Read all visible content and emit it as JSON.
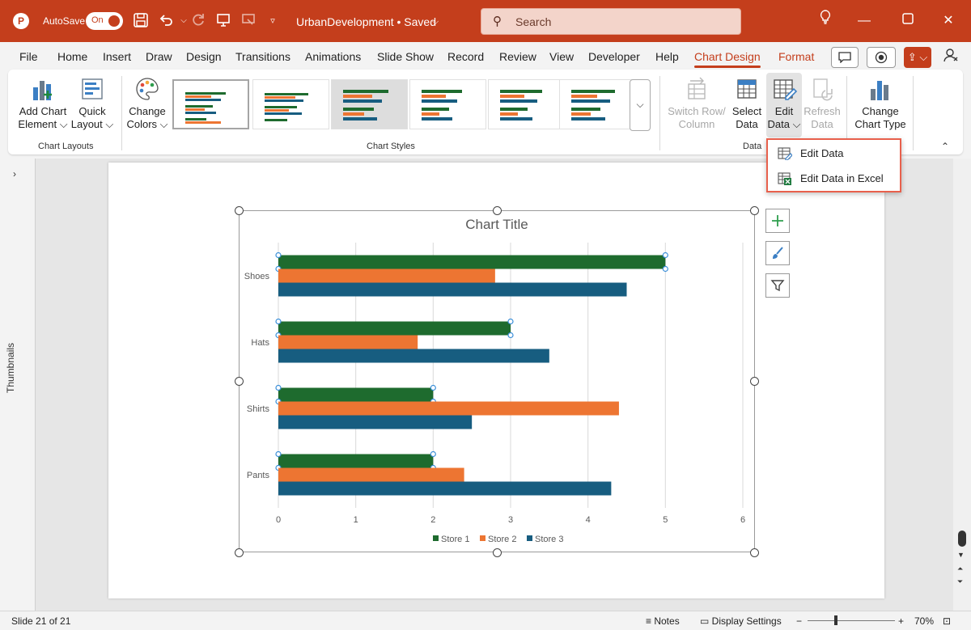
{
  "titlebar": {
    "app_icon": "P",
    "autosave_label": "AutoSave",
    "autosave_state": "On",
    "doc_title": "UrbanDevelopment • Saved",
    "search_placeholder": "Search",
    "icons": [
      "save-icon",
      "undo-icon",
      "redo-icon",
      "present-icon",
      "customize-icon",
      "lightbulb-icon",
      "minimize-icon",
      "maximize-icon",
      "close-icon"
    ]
  },
  "menu": {
    "tabs": [
      "File",
      "Home",
      "Insert",
      "Draw",
      "Design",
      "Transitions",
      "Animations",
      "Slide Show",
      "Record",
      "Review",
      "View",
      "Developer",
      "Help",
      "Chart Design",
      "Format"
    ],
    "active": "Chart Design"
  },
  "ribbon": {
    "add_chart_element": "Add Chart Element",
    "add_chart_line1": "Add Chart",
    "add_chart_line2": "Element",
    "quick_layout_line1": "Quick",
    "quick_layout_line2": "Layout",
    "chart_layouts_label": "Chart Layouts",
    "change_colors_line1": "Change",
    "change_colors_line2": "Colors",
    "chart_styles_label": "Chart Styles",
    "switch_line1": "Switch Row/",
    "switch_line2": "Column",
    "select_line1": "Select",
    "select_line2": "Data",
    "edit_line1": "Edit",
    "edit_line2": "Data",
    "refresh_line1": "Refresh",
    "refresh_line2": "Data",
    "data_label": "Data",
    "change_type_line1": "Change",
    "change_type_line2": "Chart Type"
  },
  "dropdown": {
    "items": [
      "Edit Data",
      "Edit Data in Excel"
    ]
  },
  "side_panel": {
    "thumbnails_label": "Thumbnails"
  },
  "chart_data": {
    "type": "bar",
    "orientation": "horizontal",
    "title": "Chart Title",
    "categories": [
      "Shoes",
      "Hats",
      "Shirts",
      "Pants"
    ],
    "series": [
      {
        "name": "Store 1",
        "color": "#1e6b2e",
        "values": [
          5,
          3,
          2,
          2
        ]
      },
      {
        "name": "Store 2",
        "color": "#ed7532",
        "values": [
          2.8,
          1.8,
          4.4,
          2.4
        ]
      },
      {
        "name": "Store 3",
        "color": "#175d80",
        "values": [
          4.5,
          3.5,
          2.5,
          4.3
        ]
      }
    ],
    "xlim": [
      0,
      6
    ],
    "xticks": [
      "0",
      "1",
      "2",
      "3",
      "4",
      "5",
      "6"
    ],
    "grid": true,
    "legend": "bottom"
  },
  "statusbar": {
    "slide_info": "Slide 21 of 21",
    "notes": "Notes",
    "display_settings": "Display Settings",
    "zoom": "70%"
  }
}
